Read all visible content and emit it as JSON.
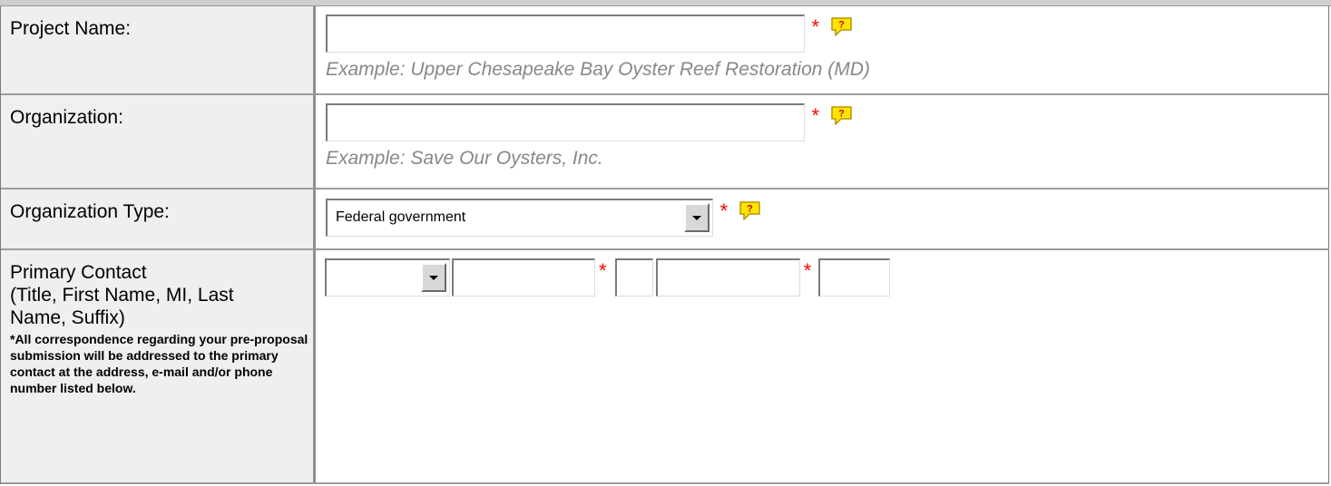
{
  "form": {
    "project_name": {
      "label": "Project Name:",
      "value": "",
      "required_mark": "*",
      "example": "Example: Upper Chesapeake Bay Oyster Reef Restoration (MD)"
    },
    "organization": {
      "label": "Organization:",
      "value": "",
      "required_mark": "*",
      "example": "Example: Save Our Oysters, Inc."
    },
    "organization_type": {
      "label": "Organization Type:",
      "selected": "Federal government",
      "required_mark": "*"
    },
    "primary_contact": {
      "label_lines": [
        "Primary Contact",
        "(Title, First Name, MI, Last",
        "Name, Suffix)"
      ],
      "note": "*All correspondence regarding your pre-proposal submission will be addressed to the primary contact at the address, e-mail and/or phone number listed below.",
      "title_selected": "",
      "first_name": "",
      "mi": "",
      "last_name": "",
      "suffix": "",
      "required_mark": "*"
    }
  },
  "colors": {
    "required": "#ff0000",
    "example_text": "#888888",
    "label_background": "#efefef",
    "help_icon_fill": "#ffe600"
  },
  "icons": {
    "help": "help-question-bubble-icon"
  }
}
